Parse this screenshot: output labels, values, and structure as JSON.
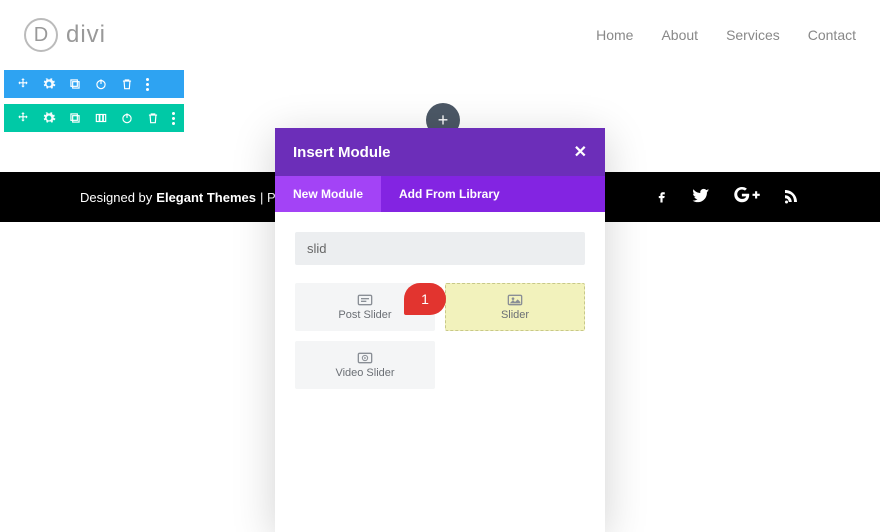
{
  "header": {
    "logo_letter": "D",
    "logo_text": "divi",
    "nav": [
      "Home",
      "About",
      "Services",
      "Contact"
    ]
  },
  "add_button_label": "+",
  "footer": {
    "prefix": "Designed by",
    "brand": "Elegant Themes",
    "separator": "| Pow"
  },
  "modal": {
    "title": "Insert Module",
    "tabs": {
      "new": "New Module",
      "library": "Add From Library"
    },
    "search_value": "slid",
    "modules": [
      {
        "label": "Post Slider",
        "highlight": false
      },
      {
        "label": "Slider",
        "highlight": true
      },
      {
        "label": "Video Slider",
        "highlight": false
      }
    ]
  },
  "callout": {
    "number": "1"
  }
}
